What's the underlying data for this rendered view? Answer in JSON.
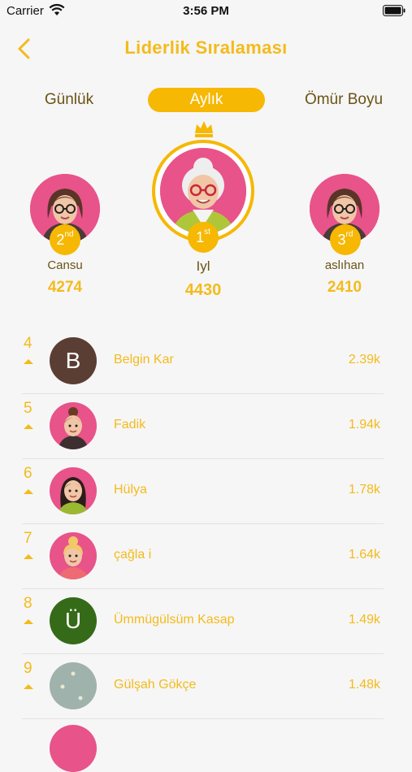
{
  "status_bar": {
    "carrier": "Carrier",
    "time": "3:56 PM"
  },
  "header": {
    "title": "Liderlik Sıralaması",
    "back_icon": "chevron-left-icon"
  },
  "tabs": [
    {
      "label": "Günlük",
      "active": false
    },
    {
      "label": "Aylık",
      "active": true
    },
    {
      "label": "Ömür Boyu",
      "active": false
    }
  ],
  "podium": {
    "first": {
      "rank": "1",
      "suffix": "st",
      "name": "Iyl",
      "score": "4430"
    },
    "second": {
      "rank": "2",
      "suffix": "nd",
      "name": "Cansu",
      "score": "4274"
    },
    "third": {
      "rank": "3",
      "suffix": "rd",
      "name": "aslıhan",
      "score": "2410"
    }
  },
  "list": [
    {
      "rank": "4",
      "name": "Belgin Kar",
      "score": "2.39k",
      "avatar": "letter",
      "letter": "B",
      "color": "#5b3e33"
    },
    {
      "rank": "5",
      "name": "Fadik",
      "score": "1.94k",
      "avatar": "woman-bun-icon",
      "color": "#e8538a"
    },
    {
      "rank": "6",
      "name": "Hülya",
      "score": "1.78k",
      "avatar": "woman-long-hair-icon",
      "color": "#e8538a"
    },
    {
      "rank": "7",
      "name": "çağla i",
      "score": "1.64k",
      "avatar": "woman-blonde-icon",
      "color": "#e8538a"
    },
    {
      "rank": "8",
      "name": "Ümmügülsüm Kasap",
      "score": "1.49k",
      "avatar": "letter",
      "letter": "Ü",
      "color": "#356b18"
    },
    {
      "rank": "9",
      "name": "Gülşah Gökçe",
      "score": "1.48k",
      "avatar": "photo",
      "color": "#9fb2ac"
    }
  ],
  "colors": {
    "accent": "#f6b802",
    "text_brown": "#6b5316",
    "avatar_pink": "#e8538a"
  }
}
